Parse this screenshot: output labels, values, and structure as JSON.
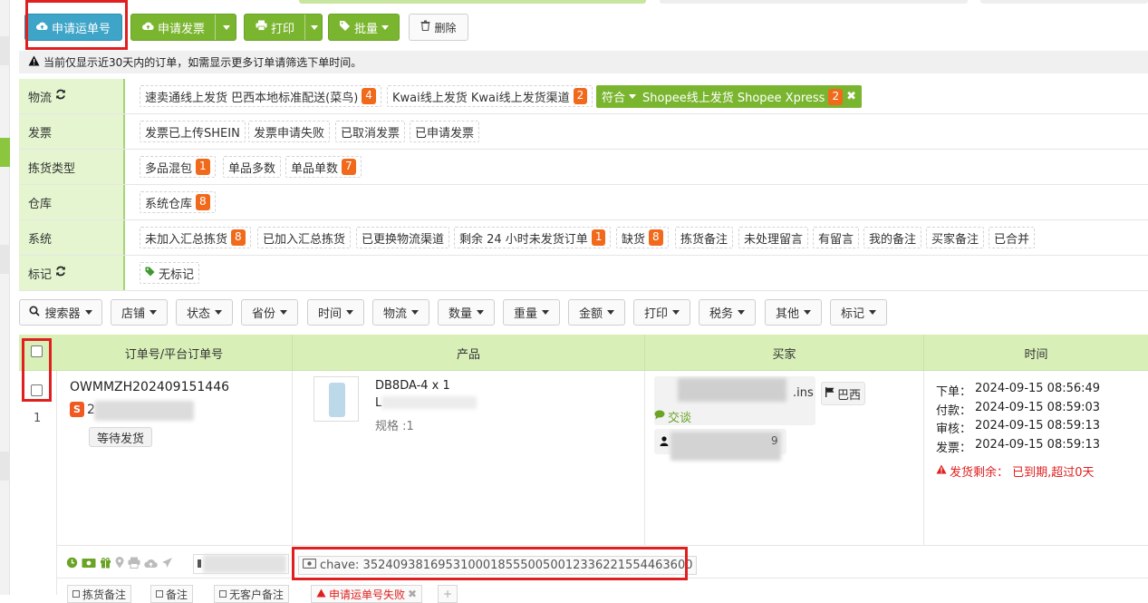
{
  "toolbar": {
    "apply_waybill": "申请运单号",
    "apply_invoice": "申请发票",
    "print": "打印",
    "batch": "批量",
    "delete": "删除"
  },
  "notice": "当前仅显示近30天内的订单，如需显示更多订单请筛选下单时间。",
  "filters": {
    "logistics": {
      "label": "物流",
      "chips": [
        {
          "text": "速卖通线上发货 巴西本地标准配送(菜鸟)",
          "count": "4"
        },
        {
          "text": "Kwai线上发货 Kwai线上发货渠道",
          "count": "2"
        }
      ],
      "active": {
        "prefix": "符合",
        "text": "Shopee线上发货 Shopee Xpress",
        "count": "2"
      }
    },
    "invoice": {
      "label": "发票",
      "chips": [
        "发票已上传SHEIN",
        "发票申请失败",
        "已取消发票",
        "已申请发票"
      ]
    },
    "pick_type": {
      "label": "拣货类型",
      "chips": [
        {
          "text": "多品混包",
          "count": "1"
        },
        {
          "text": "单品多数",
          "count": ""
        },
        {
          "text": "单品单数",
          "count": "7"
        }
      ]
    },
    "warehouse": {
      "label": "仓库",
      "chips": [
        {
          "text": "系统仓库",
          "count": "8"
        }
      ]
    },
    "system": {
      "label": "系统",
      "chips": [
        {
          "text": "未加入汇总拣货",
          "count": "8"
        },
        {
          "text": "已加入汇总拣货",
          "count": ""
        },
        {
          "text": "已更换物流渠道",
          "count": ""
        },
        {
          "text": "剩余 24 小时未发货订单",
          "count": "1"
        },
        {
          "text": "缺货",
          "count": "8"
        },
        {
          "text": "拣货备注",
          "count": ""
        },
        {
          "text": "未处理留言",
          "count": ""
        },
        {
          "text": "有留言",
          "count": ""
        },
        {
          "text": "我的备注",
          "count": ""
        },
        {
          "text": "买家备注",
          "count": ""
        },
        {
          "text": "已合并",
          "count": ""
        }
      ]
    },
    "mark": {
      "label": "标记",
      "chips": [
        "无标记"
      ]
    }
  },
  "dropdowns": [
    "搜索器",
    "店铺",
    "状态",
    "省份",
    "时间",
    "物流",
    "数量",
    "重量",
    "金额",
    "打印",
    "税务",
    "其他",
    "标记"
  ],
  "table": {
    "headers": [
      "订单号/平台订单号",
      "产品",
      "买家",
      "时间"
    ]
  },
  "order": {
    "row_no": "1",
    "order_no": "OWMMZH202409151446",
    "platform_prefix": "2",
    "status": "等待发货",
    "product": {
      "sku": "DB8DA-4 x 1",
      "sub": "L",
      "spec": "规格 :1"
    },
    "buyer": {
      "name_tail": ".ins",
      "country": "巴西",
      "chat": "交谈",
      "extra": "9"
    },
    "times": [
      {
        "label": "下单：",
        "value": "2024-09-15 08:56:49"
      },
      {
        "label": "付款：",
        "value": "2024-09-15 08:59:03"
      },
      {
        "label": "审核：",
        "value": "2024-09-15 08:59:13"
      },
      {
        "label": "发票：",
        "value": "2024-09-15 08:59:13"
      }
    ],
    "deadline": "发货剩余： 已到期,超过0天",
    "chave": "chave: 35240938169531000185550050012336221554463600"
  },
  "bottom": {
    "pick_note": "拣货备注",
    "note": "备注",
    "no_customer_note": "无客户备注",
    "waybill_failed": "申请运单号失败"
  },
  "colors": {
    "green": "#7ab530",
    "teal": "#3ea4c8",
    "badge_orange": "#f16a1c",
    "highlight_red": "#e02020",
    "label_bg": "#e4f5cf",
    "header_bg": "#d8f0b8"
  }
}
